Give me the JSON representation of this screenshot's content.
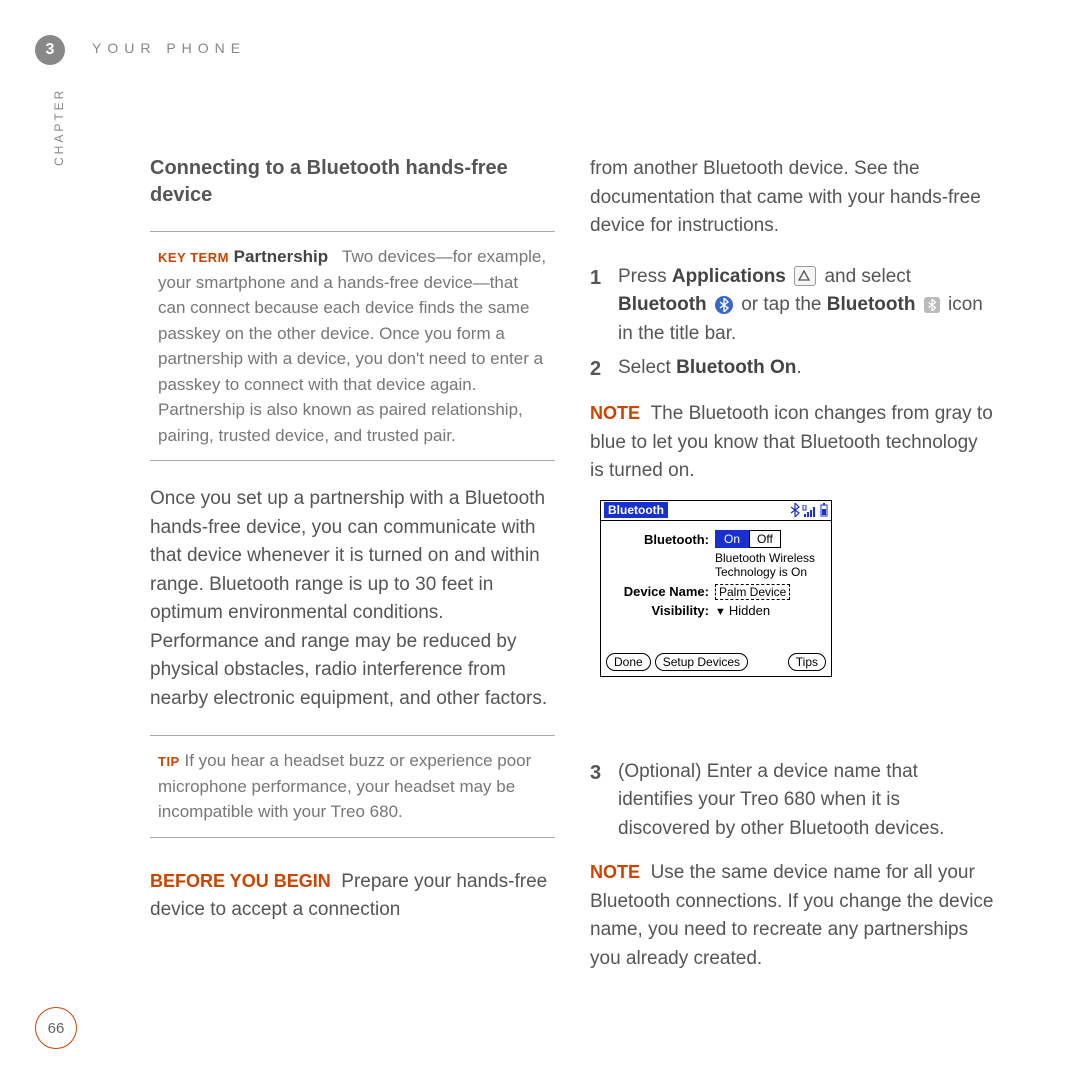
{
  "header": {
    "chapter_number": "3",
    "running_head": "YOUR PHONE",
    "chapter_label": "CHAPTER"
  },
  "left": {
    "section_title": "Connecting to a Bluetooth hands-free device",
    "key_term": {
      "label": "KEY TERM",
      "term": "Partnership",
      "text": "Two devices—for example, your smartphone and a hands-free device—that can connect because each device finds the same passkey on the other device. Once you form a partnership with a device, you don't need to enter a passkey to connect with that device again. Partnership is also known as paired relationship, pairing, trusted device, and trusted pair."
    },
    "body1": "Once you set up a partnership with a Bluetooth hands-free device, you can communicate with that device whenever it is turned on and within range. Bluetooth range is up to 30 feet in optimum environmental conditions. Performance and range may be reduced by physical obstacles, radio interference from nearby electronic equipment, and other factors.",
    "tip": {
      "label": "TIP",
      "text": "If you hear a headset buzz or experience poor microphone performance, your headset may be incompatible with your Treo 680."
    },
    "before_begin": {
      "label": "BEFORE YOU BEGIN",
      "text": "Prepare your hands-free device to accept a connection"
    }
  },
  "right": {
    "lead": "from another Bluetooth device. See the documentation that came with your hands-free device for instructions.",
    "steps": {
      "s1": {
        "num": "1",
        "a": "Press ",
        "b": "Applications",
        "c": " and select ",
        "d": "Bluetooth",
        "e": " or tap the ",
        "f": "Bluetooth",
        "g": " icon in the title bar."
      },
      "s2": {
        "num": "2",
        "a": "Select ",
        "b": "Bluetooth On",
        "c": "."
      },
      "s3": {
        "num": "3",
        "text": "(Optional)  Enter a device name that identifies your Treo 680 when it is discovered by other Bluetooth devices."
      }
    },
    "note1": {
      "label": "NOTE",
      "text": "The Bluetooth icon changes from gray to blue to let you know that Bluetooth technology is turned on."
    },
    "note2": {
      "label": "NOTE",
      "text": "Use the same device name for all your Bluetooth connections. If you change the device name, you need to recreate any partnerships you already created."
    }
  },
  "bt_screen": {
    "title": "Bluetooth",
    "field_bt": "Bluetooth:",
    "on": "On",
    "off": "Off",
    "status": "Bluetooth Wireless Technology is On",
    "field_name": "Device Name:",
    "name_value": "Palm Device",
    "field_visibility": "Visibility:",
    "visibility_value": "Hidden",
    "btn_done": "Done",
    "btn_setup": "Setup Devices",
    "btn_tips": "Tips"
  },
  "page_number": "66"
}
